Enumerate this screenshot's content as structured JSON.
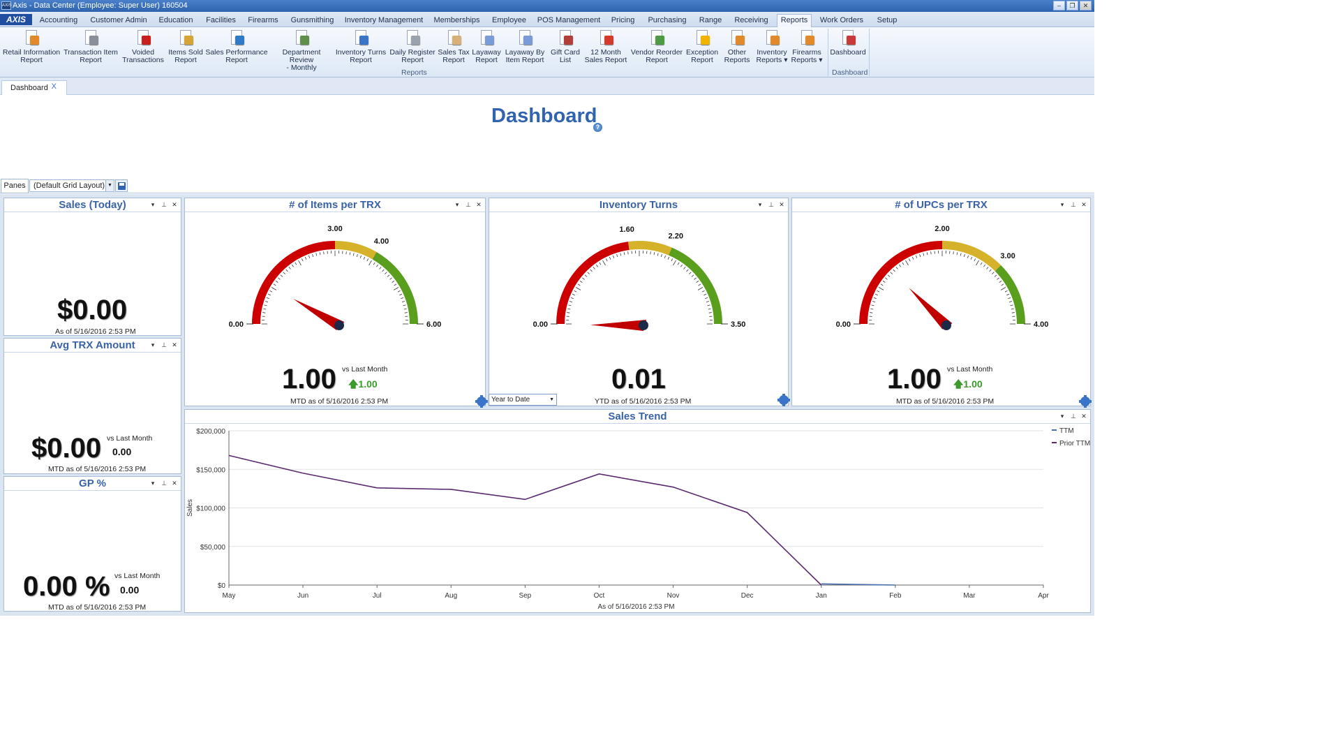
{
  "window": {
    "title": "Axis - Data Center  (Employee: Super User) 160504",
    "logo_text": "AXIS",
    "minimize": "–",
    "restore": "❐",
    "close": "✕"
  },
  "menu": {
    "app_logo": "AXIS",
    "tabs": [
      "Accounting",
      "Customer Admin",
      "Education",
      "Facilities",
      "Firearms",
      "Gunsmithing",
      "Inventory Management",
      "Memberships",
      "Employee",
      "POS Management",
      "Pricing",
      "Purchasing",
      "Range",
      "Receiving",
      "Reports",
      "Work Orders",
      "Setup"
    ],
    "active_tab": "Reports"
  },
  "ribbon": {
    "reports_group_label": "Reports",
    "dashboard_group_label": "Dashboard",
    "buttons": [
      {
        "line1": "Retail Information",
        "line2": "Report",
        "icon": "report-icon",
        "color": "#e08a2c"
      },
      {
        "line1": "Transaction Item",
        "line2": "Report",
        "icon": "pen-icon",
        "color": "#8a8f99"
      },
      {
        "line1": "Voided",
        "line2": "Transactions",
        "icon": "void-icon",
        "color": "#c81e1e"
      },
      {
        "line1": "Items Sold",
        "line2": "Report",
        "icon": "bar-chart-icon",
        "color": "#d4a437"
      },
      {
        "line1": "Sales Performance",
        "line2": "Report",
        "icon": "performance-chart-icon",
        "color": "#2f7ac8"
      },
      {
        "line1": "Department Review",
        "line2": "- Monthly",
        "icon": "chart-disk-icon",
        "color": "#5f8f4a"
      },
      {
        "line1": "Inventory Turns",
        "line2": "Report",
        "icon": "boxes-icon",
        "color": "#3a74c8"
      },
      {
        "line1": "Daily Register",
        "line2": "Report",
        "icon": "register-report-icon",
        "color": "#9aa3ad"
      },
      {
        "line1": "Sales Tax",
        "line2": "Report",
        "icon": "tax-report-icon",
        "color": "#d8b07a"
      },
      {
        "line1": "Layaway",
        "line2": "Report",
        "icon": "layaway-report-icon",
        "color": "#7a9cd6"
      },
      {
        "line1": "Layaway By",
        "line2": "Item Report",
        "icon": "layaway-item-icon",
        "color": "#7a9cd6"
      },
      {
        "line1": "Gift Card",
        "line2": "List",
        "icon": "gift-card-icon",
        "color": "#b2403a"
      },
      {
        "line1": "12 Month",
        "line2": "Sales Report",
        "icon": "calendar-icon",
        "color": "#d33a2c"
      },
      {
        "line1": "Vendor Reorder",
        "line2": "Report",
        "icon": "vendor-reorder-icon",
        "color": "#4f9a45"
      },
      {
        "line1": "Exception",
        "line2": "Report",
        "icon": "exception-dollar-icon",
        "color": "#f0b400"
      },
      {
        "line1": "Other",
        "line2": "Reports",
        "icon": "other-reports-icon",
        "color": "#e08a2c"
      },
      {
        "line1": "Inventory",
        "line2": "Reports ▾",
        "icon": "inventory-reports-icon",
        "color": "#e08a2c"
      },
      {
        "line1": "Firearms",
        "line2": "Reports ▾",
        "icon": "firearms-reports-icon",
        "color": "#e08a2c"
      },
      {
        "line1": "Dashboard",
        "line2": "",
        "icon": "dashboard-icon",
        "color": "#c83a3a"
      }
    ]
  },
  "doc_tab": {
    "label": "Dashboard",
    "close": "X"
  },
  "page": {
    "title": "Dashboard",
    "help": "?"
  },
  "layout_bar": {
    "panes": "Panes",
    "layout": "(Default Grid Layout)"
  },
  "panels": {
    "sales_today": {
      "title": "Sales (Today)",
      "value": "$0.00",
      "asof": "As of 5/16/2016 2:53 PM"
    },
    "avg_trx": {
      "title": "Avg TRX Amount",
      "value": "$0.00",
      "vs_label": "vs Last Month",
      "vs_value": "0.00",
      "asof": "MTD as of 5/16/2016 2:53 PM"
    },
    "gp": {
      "title": "GP %",
      "value": "0.00 %",
      "vs_label": "vs Last Month",
      "vs_value": "0.00",
      "asof": "MTD as of 5/16/2016 2:53 PM"
    },
    "items_per_trx": {
      "title": "# of Items per TRX",
      "value": "1.00",
      "vs_label": "vs Last Month",
      "vs_value": "1.00",
      "asof": "MTD as of 5/16/2016 2:53 PM",
      "gauge": {
        "min": 0,
        "max": 6,
        "red_end": 3,
        "yellow_end": 4,
        "needle": 1.0,
        "labels": [
          "0.00",
          "3.00",
          "4.00",
          "6.00"
        ]
      }
    },
    "inventory_turns": {
      "title": "Inventory Turns",
      "value": "0.01",
      "asof": "YTD as of 5/16/2016 2:53 PM",
      "period": "Year to Date",
      "gauge": {
        "min": 0,
        "max": 3.5,
        "red_end": 1.6,
        "yellow_end": 2.2,
        "needle": 0.01,
        "labels": [
          "0.00",
          "1.60",
          "2.20",
          "3.50"
        ]
      }
    },
    "upcs_per_trx": {
      "title": "# of UPCs per TRX",
      "value": "1.00",
      "vs_label": "vs Last Month",
      "vs_value": "1.00",
      "asof": "MTD as of 5/16/2016 2:53 PM",
      "gauge": {
        "min": 0,
        "max": 4,
        "red_end": 2,
        "yellow_end": 3,
        "needle": 1.0,
        "labels": [
          "0.00",
          "2.00",
          "3.00",
          "4.00"
        ]
      }
    },
    "sales_trend": {
      "title": "Sales Trend",
      "asof": "As of 5/16/2016 2:53 PM"
    }
  },
  "colors": {
    "red": "#cc0000",
    "yellow": "#d6b12a",
    "green": "#5a9e1e",
    "needle": "#c00000",
    "ttm": "#4a6fb0",
    "prior": "#5b2a6e"
  },
  "chart_data": {
    "type": "line",
    "categories": [
      "May",
      "Jun",
      "Jul",
      "Aug",
      "Sep",
      "Oct",
      "Nov",
      "Dec",
      "Jan",
      "Feb",
      "Mar",
      "Apr"
    ],
    "ylabel": "Sales",
    "ylim": [
      0,
      200000
    ],
    "yticks": [
      "$0",
      "$50,000",
      "$100,000",
      "$150,000",
      "$200,000"
    ],
    "legend_position": "top-right",
    "series": [
      {
        "name": "TTM",
        "values": [
          null,
          null,
          null,
          null,
          null,
          null,
          null,
          null,
          1500,
          0,
          null,
          null
        ]
      },
      {
        "name": "Prior TTM",
        "values": [
          168000,
          145000,
          126000,
          124000,
          111000,
          144000,
          127000,
          94000,
          0,
          null,
          null,
          null
        ]
      }
    ]
  }
}
